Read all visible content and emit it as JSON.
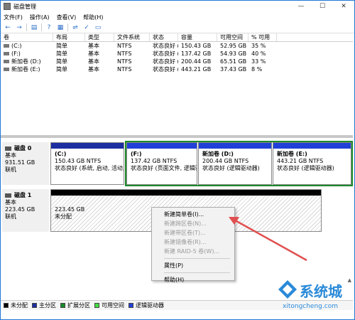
{
  "window": {
    "title": "磁盘管理",
    "minimize_label": "—",
    "maximize_label": "☐",
    "close_label": "✕"
  },
  "menubar": [
    "文件(F)",
    "操作(A)",
    "查看(V)",
    "帮助(H)"
  ],
  "toolbar": {
    "icons": [
      "back-icon",
      "forward-icon",
      "console-icon",
      "help-icon",
      "properties-icon",
      "refresh-icon",
      "check-icon",
      "disk-icon"
    ]
  },
  "volume_table": {
    "headers": [
      "卷",
      "布局",
      "类型",
      "文件系统",
      "状态",
      "容量",
      "可用空间",
      "% 可用"
    ],
    "rows": [
      [
        "(C:)",
        "简单",
        "基本",
        "NTFS",
        "状态良好 (...",
        "150.43 GB",
        "52.95 GB",
        "35 %"
      ],
      [
        "(F:)",
        "简单",
        "基本",
        "NTFS",
        "状态良好 (...",
        "137.42 GB",
        "54.93 GB",
        "40 %"
      ],
      [
        "新加卷 (D:)",
        "简单",
        "基本",
        "NTFS",
        "状态良好 (...",
        "200.44 GB",
        "65.51 GB",
        "33 %"
      ],
      [
        "新加卷 (E:)",
        "简单",
        "基本",
        "NTFS",
        "状态良好 (...",
        "443.21 GB",
        "37.43 GB",
        "8 %"
      ]
    ]
  },
  "disks": [
    {
      "name": "磁盘 0",
      "kind": "基本",
      "size": "931.51 GB",
      "status": "联机",
      "partitions": [
        {
          "name": "(C:)",
          "size": "150.43 GB NTFS",
          "status": "状态良好 (系统, 启动, 活动, 故"
        },
        {
          "name": "(F:)",
          "size": "137.42 GB NTFS",
          "status": "状态良好 (页面文件, 逻辑驱动"
        },
        {
          "name": "新加卷 (D:)",
          "size": "200.44 GB NTFS",
          "status": "状态良好 (逻辑驱动器)"
        },
        {
          "name": "新加卷 (E:)",
          "size": "443.21 GB NTFS",
          "status": "状态良好 (逻辑驱动器)"
        }
      ]
    },
    {
      "name": "磁盘 1",
      "kind": "基本",
      "size": "223.45 GB",
      "status": "联机",
      "partitions": [
        {
          "name": "",
          "size": "223.45 GB",
          "status": "未分配"
        }
      ]
    }
  ],
  "context_menu": {
    "items": [
      {
        "label": "新建简单卷(I)...",
        "enabled": true
      },
      {
        "label": "新建跨区卷(N)...",
        "enabled": false
      },
      {
        "label": "新建带区卷(T)...",
        "enabled": false
      },
      {
        "label": "新建镜像卷(R)...",
        "enabled": false
      },
      {
        "label": "新建 RAID-5 卷(W)...",
        "enabled": false
      },
      {
        "label": "属性(P)",
        "enabled": true
      },
      {
        "label": "帮助(H)",
        "enabled": true
      }
    ]
  },
  "legend": [
    {
      "label": "未分配",
      "color": "#000000"
    },
    {
      "label": "主分区",
      "color": "#1c2ea0"
    },
    {
      "label": "扩展分区",
      "color": "#1a8a2a"
    },
    {
      "label": "可用空间",
      "color": "#44dd44"
    },
    {
      "label": "逻辑驱动器",
      "color": "#2040d8"
    }
  ],
  "watermark": {
    "brand": "系统城",
    "url": "xitongcheng.com"
  },
  "colors": {
    "accent": "#1e78d6",
    "arrow": "#e05050",
    "selection": "#1a8a2a"
  }
}
